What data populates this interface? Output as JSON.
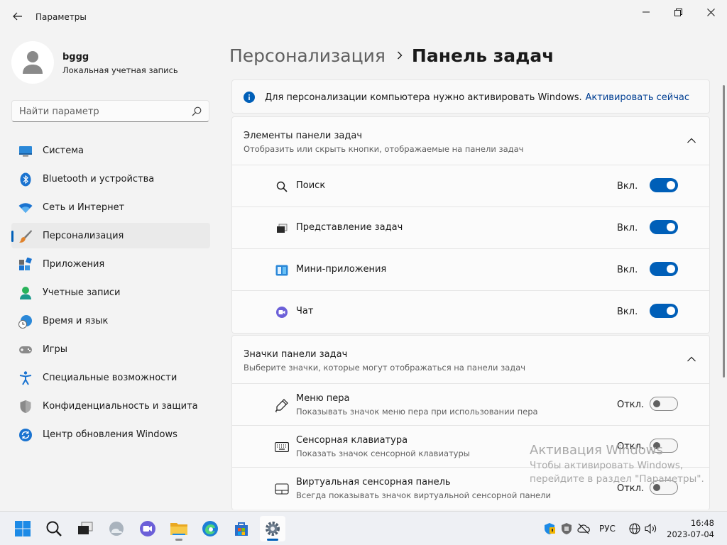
{
  "window": {
    "title": "Параметры"
  },
  "user": {
    "name": "bggg",
    "account_type": "Локальная учетная запись"
  },
  "search": {
    "placeholder": "Найти параметр"
  },
  "sidebar": {
    "active_index": 3,
    "items": [
      {
        "label": "Система",
        "icon": "monitor-icon"
      },
      {
        "label": "Bluetooth и устройства",
        "icon": "bluetooth-icon"
      },
      {
        "label": "Сеть и Интернет",
        "icon": "wifi-icon"
      },
      {
        "label": "Персонализация",
        "icon": "brush-icon"
      },
      {
        "label": "Приложения",
        "icon": "apps-icon"
      },
      {
        "label": "Учетные записи",
        "icon": "person-icon"
      },
      {
        "label": "Время и язык",
        "icon": "globe-clock-icon"
      },
      {
        "label": "Игры",
        "icon": "gamepad-icon"
      },
      {
        "label": "Специальные возможности",
        "icon": "accessibility-icon"
      },
      {
        "label": "Конфиденциальность и защита",
        "icon": "shield-icon"
      },
      {
        "label": "Центр обновления Windows",
        "icon": "update-icon"
      }
    ]
  },
  "breadcrumb": {
    "parent": "Персонализация",
    "current": "Панель задач"
  },
  "activation_banner": {
    "text": "Для персонализации компьютера нужно активировать Windows.",
    "link": "Активировать сейчас"
  },
  "taskbar_items": {
    "title": "Элементы панели задач",
    "description": "Отобразить или скрыть кнопки, отображаемые на панели задач",
    "rows": [
      {
        "label": "Поиск",
        "state": "Вкл.",
        "on": true,
        "icon": "search-icon"
      },
      {
        "label": "Представление задач",
        "state": "Вкл.",
        "on": true,
        "icon": "task-view-icon"
      },
      {
        "label": "Мини-приложения",
        "state": "Вкл.",
        "on": true,
        "icon": "widgets-icon"
      },
      {
        "label": "Чат",
        "state": "Вкл.",
        "on": true,
        "icon": "chat-icon"
      }
    ]
  },
  "taskbar_icons": {
    "title": "Значки панели задач",
    "description": "Выберите значки, которые могут отображаться на панели задач",
    "rows": [
      {
        "label": "Меню пера",
        "description": "Показывать значок меню пера при использовании пера",
        "state": "Откл.",
        "on": false,
        "icon": "pen-icon"
      },
      {
        "label": "Сенсорная клавиатура",
        "description": "Показать значок сенсорной клавиатуры",
        "state": "Откл.",
        "on": false,
        "icon": "keyboard-icon"
      },
      {
        "label": "Виртуальная сенсорная панель",
        "description": "Всегда показывать значок виртуальной сенсорной панели",
        "state": "Откл.",
        "on": false,
        "icon": "touchpad-icon"
      }
    ]
  },
  "watermark": {
    "title": "Активация Windows",
    "line1": "Чтобы активировать Windows,",
    "line2": "перейдите в раздел \"Параметры\"."
  },
  "system_tray": {
    "language": "РУС",
    "time": "16:48",
    "date": "2023-07-04"
  },
  "colors": {
    "accent": "#005fb8",
    "background": "#f3f3f3",
    "card": "#fbfbfb"
  }
}
